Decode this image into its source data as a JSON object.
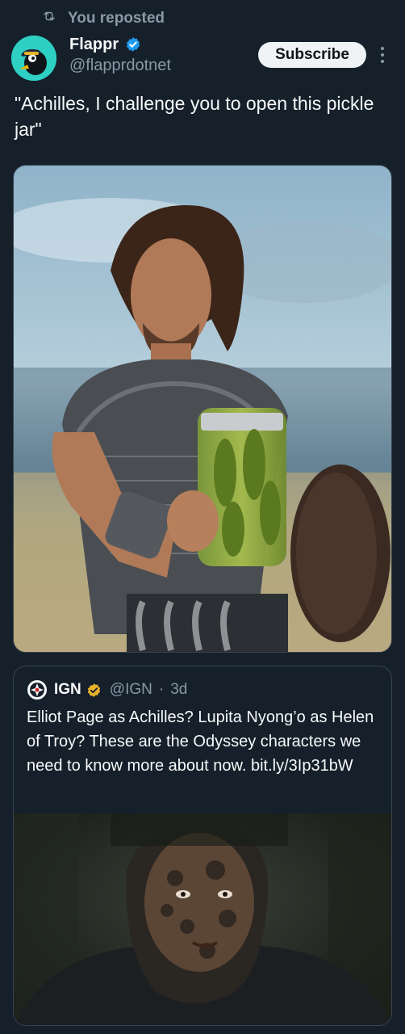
{
  "repost": {
    "icon": "repost-icon",
    "label": "You reposted"
  },
  "author": {
    "display_name": "Flappr",
    "handle": "@flapprdotnet",
    "avatar_icon": "flappr-logo",
    "verified_color": "#1d9bf0"
  },
  "actions": {
    "subscribe_label": "Subscribe",
    "more_icon": "more-icon"
  },
  "post": {
    "text": "\"Achilles, I challenge you to open this pickle jar\""
  },
  "media": {
    "description_icon": "photo-warrior-holding-pickle-jar"
  },
  "quoted": {
    "display_name": "IGN",
    "handle": "@IGN",
    "separator": "·",
    "time": "3d",
    "verified_color": "#e8b32a",
    "text": "Elliot Page as Achilles? Lupita Nyong’o as Helen of Troy? These are the Odyssey characters we need to know more about now. bit.ly/3Ip31bW",
    "media_icon": "photo-muddy-face"
  },
  "colors": {
    "background": "#15202b",
    "muted": "#8b98a5",
    "border": "#38444d",
    "text": "#f7f9f9"
  }
}
